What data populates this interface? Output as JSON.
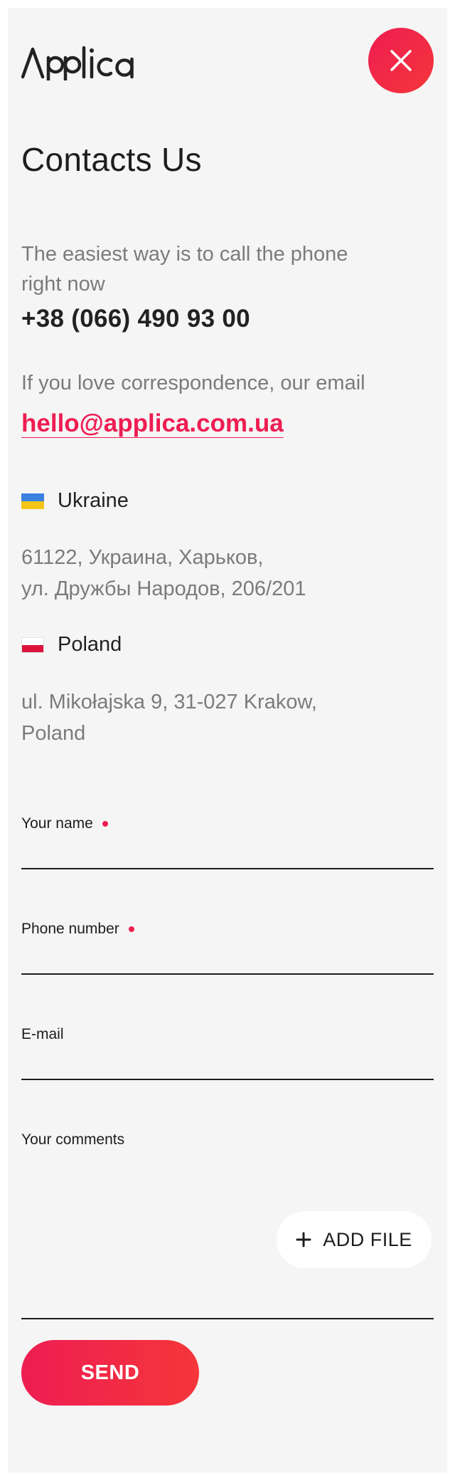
{
  "brand": {
    "logo_text": "Applica",
    "accent": "#ee1d52"
  },
  "header": {
    "close_icon": "close-icon"
  },
  "page_title": "Contacts Us",
  "contacts": {
    "call_text": "The easiest way is to call the phone right now",
    "phone": "+38 (066) 490 93 00",
    "email_text": "If you love correspondence, our email",
    "email": "hello@applica.com.ua"
  },
  "offices": [
    {
      "country": "Ukraine",
      "flag_colors": [
        "#3b82e0",
        "#f5c518"
      ],
      "address_line1": "61122, Украина, Харьков,",
      "address_line2": "ул. Дружбы Народов, 206/201"
    },
    {
      "country": "Poland",
      "flag_colors": [
        "#ffffff",
        "#dc143c"
      ],
      "address_line1": "ul. Mikołajska 9, 31-027 Krakow,",
      "address_line2": "Poland"
    }
  ],
  "form": {
    "name": {
      "label": "Your name",
      "value": "",
      "required": true
    },
    "phone": {
      "label": "Phone number",
      "value": "",
      "required": true
    },
    "email": {
      "label": "E-mail",
      "value": ""
    },
    "comments": {
      "label": "Your comments",
      "value": ""
    },
    "add_file_label": "ADD FILE",
    "send_label": "SEND"
  }
}
